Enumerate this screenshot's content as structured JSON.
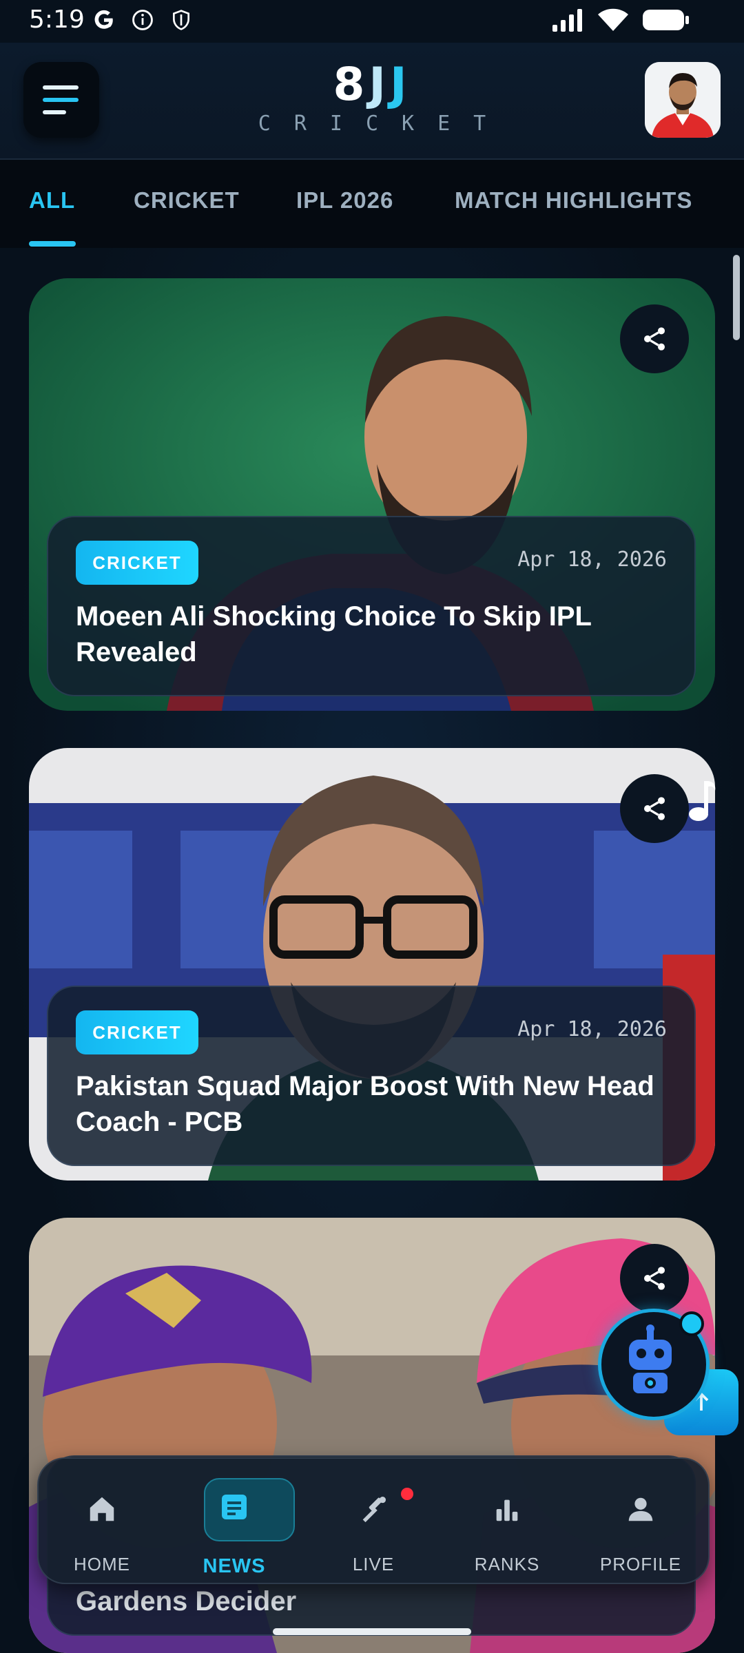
{
  "status_bar": {
    "time": "5:19"
  },
  "header": {
    "logo_digit": "8",
    "logo_j1": "J",
    "logo_j2": "J",
    "logo_sub": "CRICKET"
  },
  "tabs": [
    {
      "label": "ALL",
      "active": true
    },
    {
      "label": "CRICKET",
      "active": false
    },
    {
      "label": "IPL 2026",
      "active": false
    },
    {
      "label": "MATCH HIGHLIGHTS",
      "active": false
    }
  ],
  "cards": [
    {
      "category": "CRICKET",
      "date": "Apr 18, 2026",
      "headline": "Moeen Ali Shocking Choice To Skip IPL Revealed"
    },
    {
      "category": "CRICKET",
      "date": "Apr 18, 2026",
      "headline": "Pakistan Squad Major Boost With New Head Coach - PCB"
    },
    {
      "category": "",
      "date": "",
      "headline": "Gardens Decider"
    }
  ],
  "bottom_nav": [
    {
      "label": "HOME",
      "icon": "home-icon",
      "active": false
    },
    {
      "label": "NEWS",
      "icon": "news-icon",
      "active": true
    },
    {
      "label": "LIVE",
      "icon": "cricket-bat-icon",
      "active": false,
      "notification_dot": true
    },
    {
      "label": "RANKS",
      "icon": "bar-chart-icon",
      "active": false
    },
    {
      "label": "PROFILE",
      "icon": "person-icon",
      "active": false
    }
  ],
  "colors": {
    "accent": "#29c5f2",
    "background": "#07111c",
    "live_dot": "#ff2d3d"
  }
}
